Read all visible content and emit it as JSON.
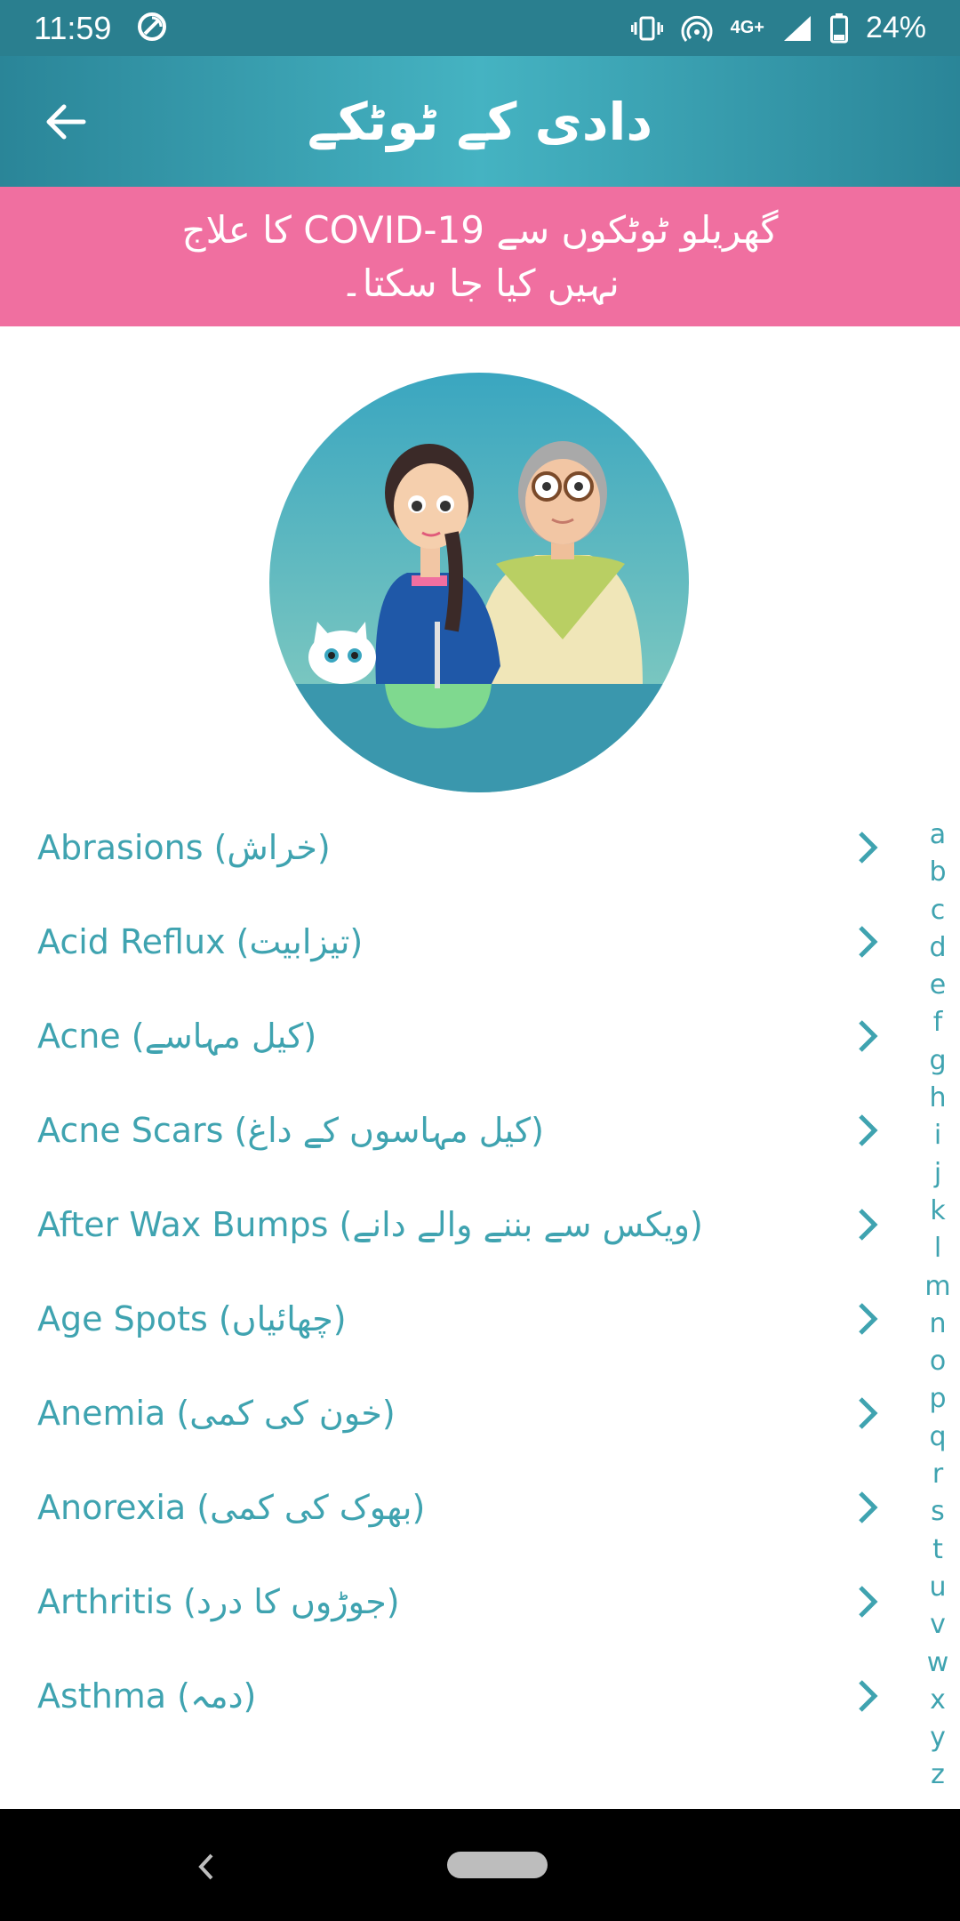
{
  "status_bar": {
    "time": "11:59",
    "network": "4G+",
    "battery": "24%"
  },
  "app_bar": {
    "title": "دادی کے ٹوٹکے",
    "back_icon": "arrow-left-icon"
  },
  "banner": {
    "line1": "گھریلو ٹوٹکوں سے COVID-19 کا علاج",
    "line2": "نہیں کیا جا سکتا۔",
    "color": "#f06fa0"
  },
  "list": {
    "items": [
      {
        "label": "Abrasions (خراش)"
      },
      {
        "label": "Acid Reflux (تیزابیت)"
      },
      {
        "label": "Acne (کیل مہاسے)"
      },
      {
        "label": "Acne Scars (کیل مہاسوں کے داغ)"
      },
      {
        "label": "After Wax Bumps (ویکس سے بننے والے دانے)"
      },
      {
        "label": "Age Spots (چھائیاں)"
      },
      {
        "label": "Anemia (خون کی کمی)"
      },
      {
        "label": "Anorexia (بھوک کی کمی)"
      },
      {
        "label": "Arthritis (جوڑوں کا درد)"
      },
      {
        "label": "Asthma (دمہ)"
      }
    ]
  },
  "alpha_index": [
    "a",
    "b",
    "c",
    "d",
    "e",
    "f",
    "g",
    "h",
    "i",
    "j",
    "k",
    "l",
    "m",
    "n",
    "o",
    "p",
    "q",
    "r",
    "s",
    "t",
    "u",
    "v",
    "w",
    "x",
    "y",
    "z"
  ],
  "colors": {
    "accent": "#3fa3b0",
    "header": "#2a8598"
  }
}
